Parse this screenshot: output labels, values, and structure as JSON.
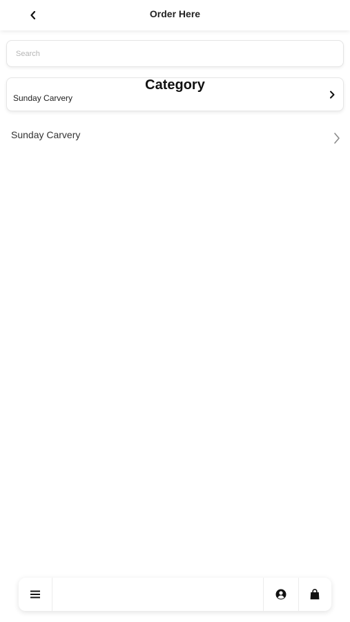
{
  "header": {
    "back_icon": "chevron-left-icon",
    "title": "Order Here"
  },
  "search": {
    "placeholder": "Search",
    "value": ""
  },
  "category": {
    "title": "Category",
    "selected_label": "Sunday Carvery",
    "selected_icon": "chevron-right-icon"
  },
  "list": {
    "items": [
      {
        "label": "Sunday Carvery",
        "icon": "chevron-right-icon"
      }
    ]
  },
  "bottom_bar": {
    "menu_icon": "menu-icon",
    "account_icon": "account-icon",
    "bag_icon": "shopping-bag-icon"
  }
}
